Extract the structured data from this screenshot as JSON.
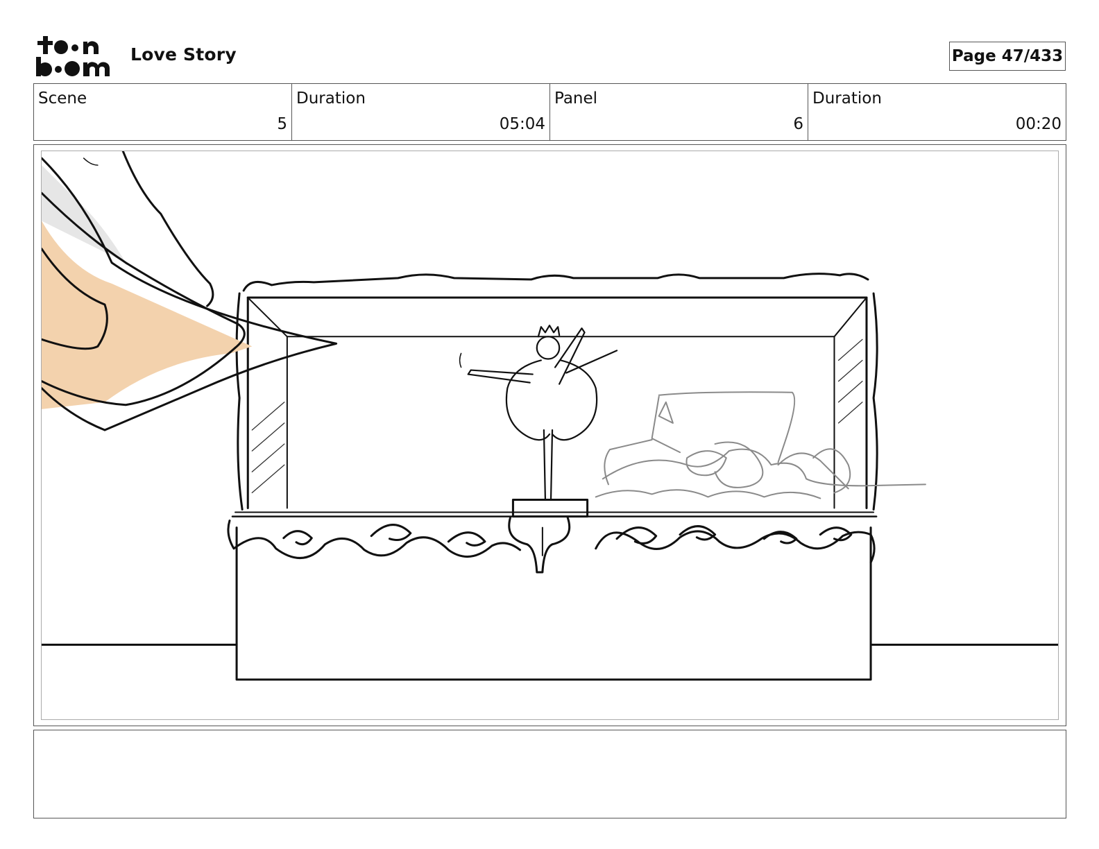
{
  "header": {
    "logo_text": "toon boom",
    "project_title": "Love Story",
    "page_label": "Page",
    "page_number": "47/433"
  },
  "info": [
    {
      "label": "Scene",
      "value": "5"
    },
    {
      "label": "Duration",
      "value": "05:04"
    },
    {
      "label": "Panel",
      "value": "6"
    },
    {
      "label": "Duration",
      "value": "00:20"
    }
  ],
  "panel": {
    "drawing": "storyboard-sketch-music-box",
    "colors": {
      "skin": "#f3d2ad",
      "sleeve": "#e6e6e6",
      "ink": "#111111",
      "pencil": "#8a8a8a"
    }
  },
  "notes": {
    "text": ""
  }
}
